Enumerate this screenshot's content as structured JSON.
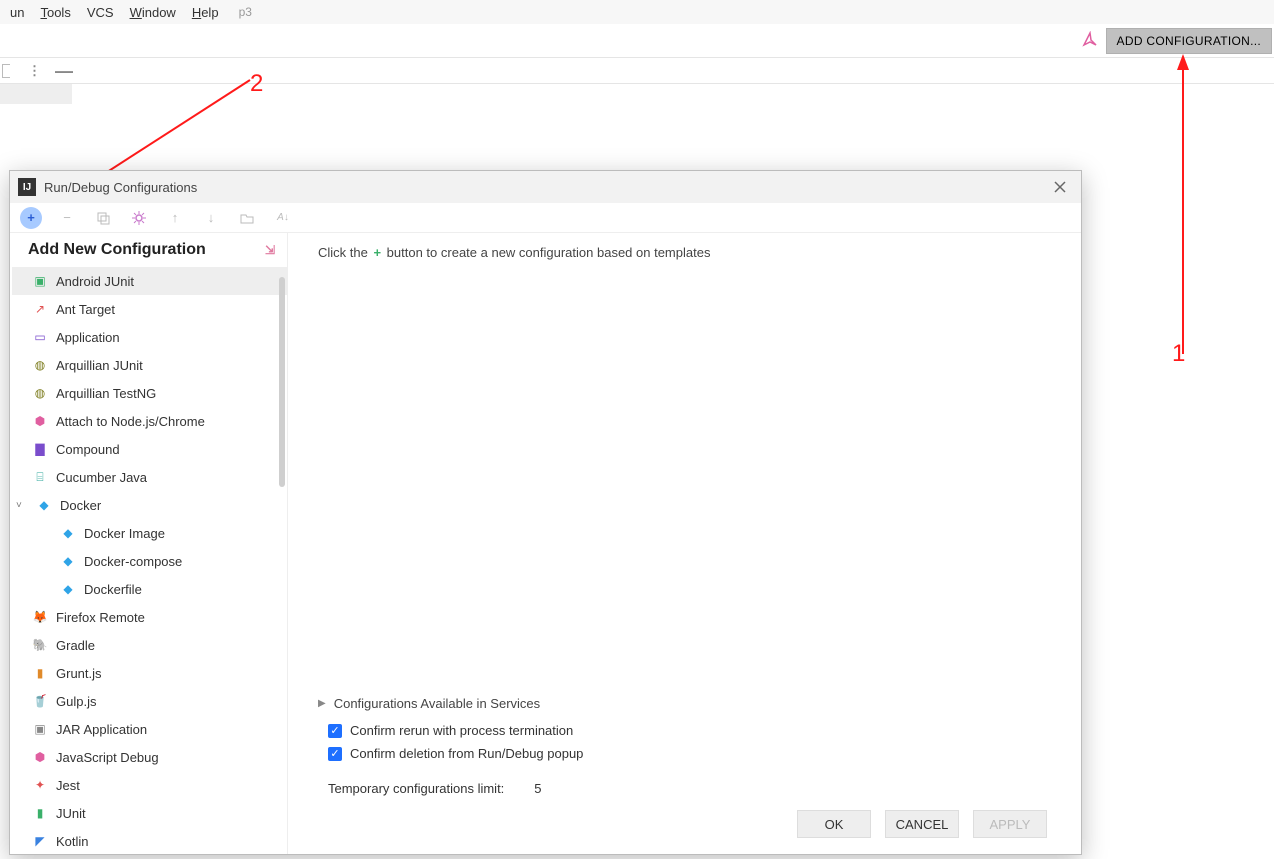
{
  "menu": {
    "run": "un",
    "tools": "Tools",
    "vcs": "VCS",
    "window": "Window",
    "help": "Help",
    "project": "p3"
  },
  "toolbar": {
    "add_config": "ADD CONFIGURATION..."
  },
  "annotation": {
    "one": "1",
    "two": "2"
  },
  "dialog": {
    "title": "Run/Debug Configurations",
    "panel_header": "Add New Configuration",
    "hint_before": "Click the ",
    "hint_after": " button to create a new configuration based on templates",
    "section_services": "Configurations Available in Services",
    "chk_rerun": "Confirm rerun with process termination",
    "chk_delete": "Confirm deletion from Run/Debug popup",
    "limit_label": "Temporary configurations limit:",
    "limit_value": "5",
    "ok": "OK",
    "cancel": "CANCEL",
    "apply": "APPLY"
  },
  "items": [
    {
      "label": "Android JUnit",
      "icon": "▣",
      "cls": "c-green",
      "selected": true
    },
    {
      "label": "Ant Target",
      "icon": "↗",
      "cls": "c-red"
    },
    {
      "label": "Application",
      "icon": "▭",
      "cls": "c-purple"
    },
    {
      "label": "Arquillian JUnit",
      "icon": "◍",
      "cls": "c-olive"
    },
    {
      "label": "Arquillian TestNG",
      "icon": "◍",
      "cls": "c-olive"
    },
    {
      "label": "Attach to Node.js/Chrome",
      "icon": "⬢",
      "cls": "c-pink"
    },
    {
      "label": "Compound",
      "icon": "▇",
      "cls": "c-purple"
    },
    {
      "label": "Cucumber Java",
      "icon": "⌸",
      "cls": "c-teal"
    },
    {
      "label": "Docker",
      "icon": "◆",
      "cls": "c-docker",
      "expandable": true,
      "expanded": true
    },
    {
      "label": "Docker Image",
      "icon": "◆",
      "cls": "c-docker",
      "sub": true
    },
    {
      "label": "Docker-compose",
      "icon": "◆",
      "cls": "c-docker",
      "sub": true
    },
    {
      "label": "Dockerfile",
      "icon": "◆",
      "cls": "c-docker",
      "sub": true
    },
    {
      "label": "Firefox Remote",
      "icon": "🦊",
      "cls": "c-fire"
    },
    {
      "label": "Gradle",
      "icon": "🐘",
      "cls": "c-green"
    },
    {
      "label": "Grunt.js",
      "icon": "▮",
      "cls": "c-orange"
    },
    {
      "label": "Gulp.js",
      "icon": "🥤",
      "cls": "c-red"
    },
    {
      "label": "JAR Application",
      "icon": "▣",
      "cls": "c-grey"
    },
    {
      "label": "JavaScript Debug",
      "icon": "⬢",
      "cls": "c-pink"
    },
    {
      "label": "Jest",
      "icon": "✦",
      "cls": "c-red"
    },
    {
      "label": "JUnit",
      "icon": "▮",
      "cls": "c-green"
    },
    {
      "label": "Kotlin",
      "icon": "◤",
      "cls": "c-blue"
    }
  ]
}
